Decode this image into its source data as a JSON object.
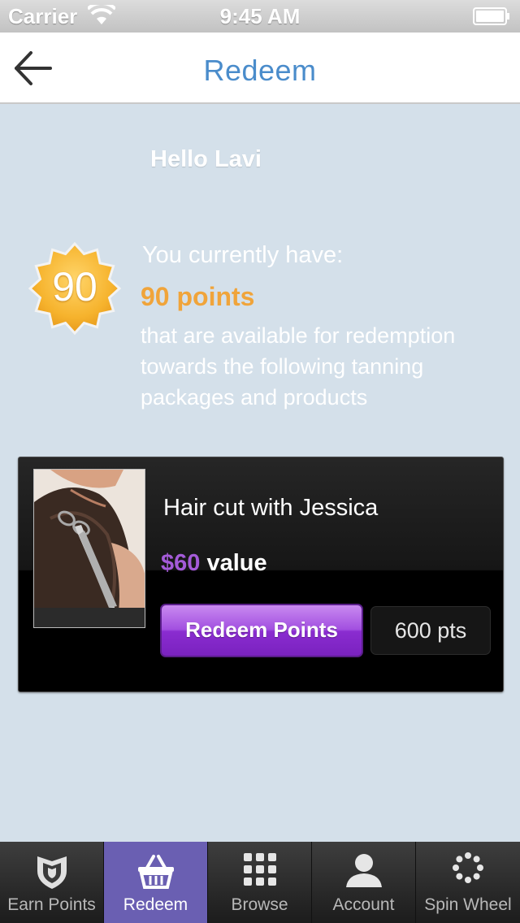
{
  "status_bar": {
    "carrier": "Carrier",
    "time": "9:45 AM"
  },
  "nav": {
    "title": "Redeem"
  },
  "greeting": "Hello Lavi",
  "points_badge": {
    "value": "90",
    "color": "#f0a43a"
  },
  "summary": {
    "intro": "You currently have:",
    "points_text": "90 points",
    "description": "that are available for redemption towards the following tanning packages and products"
  },
  "offers": [
    {
      "title": "Hair cut with Jessica",
      "price": "$60",
      "value_suffix": "value",
      "button_label": "Redeem Points",
      "cost": "600 pts",
      "image": "hair-cut-photo"
    }
  ],
  "tabs": [
    {
      "label": "Earn Points",
      "icon": "shield-icon",
      "active": false
    },
    {
      "label": "Redeem",
      "icon": "basket-icon",
      "active": true
    },
    {
      "label": "Browse",
      "icon": "grid-icon",
      "active": false
    },
    {
      "label": "Account",
      "icon": "person-icon",
      "active": false
    },
    {
      "label": "Spin Wheel",
      "icon": "spinner-icon",
      "active": false
    }
  ],
  "colors": {
    "accent_title": "#4a8ccb",
    "button_purple": "#8a2cd0",
    "price_purple": "#a45bd8",
    "active_tab": "#6a5fb2",
    "background": "#d4e0ea"
  }
}
